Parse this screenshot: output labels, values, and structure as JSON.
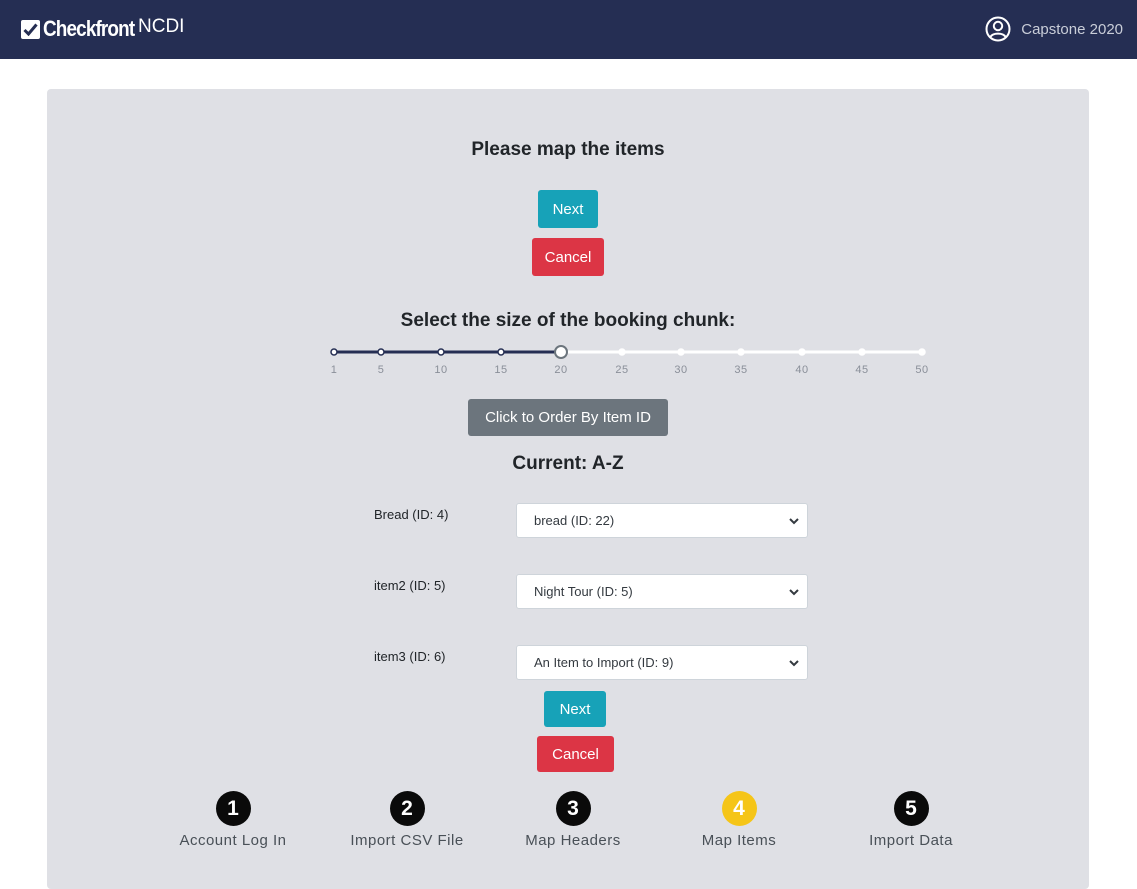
{
  "navbar": {
    "brand": "Checkfront",
    "org": "NCDI",
    "user": "Capstone 2020",
    "icons": {
      "brand": "check-square-icon",
      "user": "user-circle-icon"
    }
  },
  "main": {
    "title": "Please map the items",
    "next_label": "Next",
    "cancel_label": "Cancel",
    "chunk_title": "Select the size of the booking chunk:",
    "slider": {
      "ticks": [
        "1",
        "5",
        "10",
        "15",
        "20",
        "25",
        "30",
        "35",
        "40",
        "45",
        "50"
      ],
      "selected": "20"
    },
    "order_button": "Click to Order By Item ID",
    "current": "Current: A-Z",
    "mappings": [
      {
        "label": "Bread (ID: 4)",
        "selected": "bread (ID: 22)"
      },
      {
        "label": "item2 (ID: 5)",
        "selected": "Night Tour (ID: 5)"
      },
      {
        "label": "item3 (ID: 6)",
        "selected": "An Item to Import (ID: 9)"
      }
    ],
    "next_label_bottom": "Next",
    "cancel_label_bottom": "Cancel"
  },
  "steps": [
    {
      "number": "1",
      "label": "Account Log In",
      "active": false
    },
    {
      "number": "2",
      "label": "Import CSV File",
      "active": false
    },
    {
      "number": "3",
      "label": "Map Headers",
      "active": false
    },
    {
      "number": "4",
      "label": "Map Items",
      "active": true
    },
    {
      "number": "5",
      "label": "Import Data",
      "active": false
    }
  ],
  "colors": {
    "navbar": "#252e53",
    "next": "#17a2b8",
    "cancel": "#dc3545",
    "order": "#6c757d",
    "active_step": "#f5c518",
    "slider_track": "#252e53"
  }
}
